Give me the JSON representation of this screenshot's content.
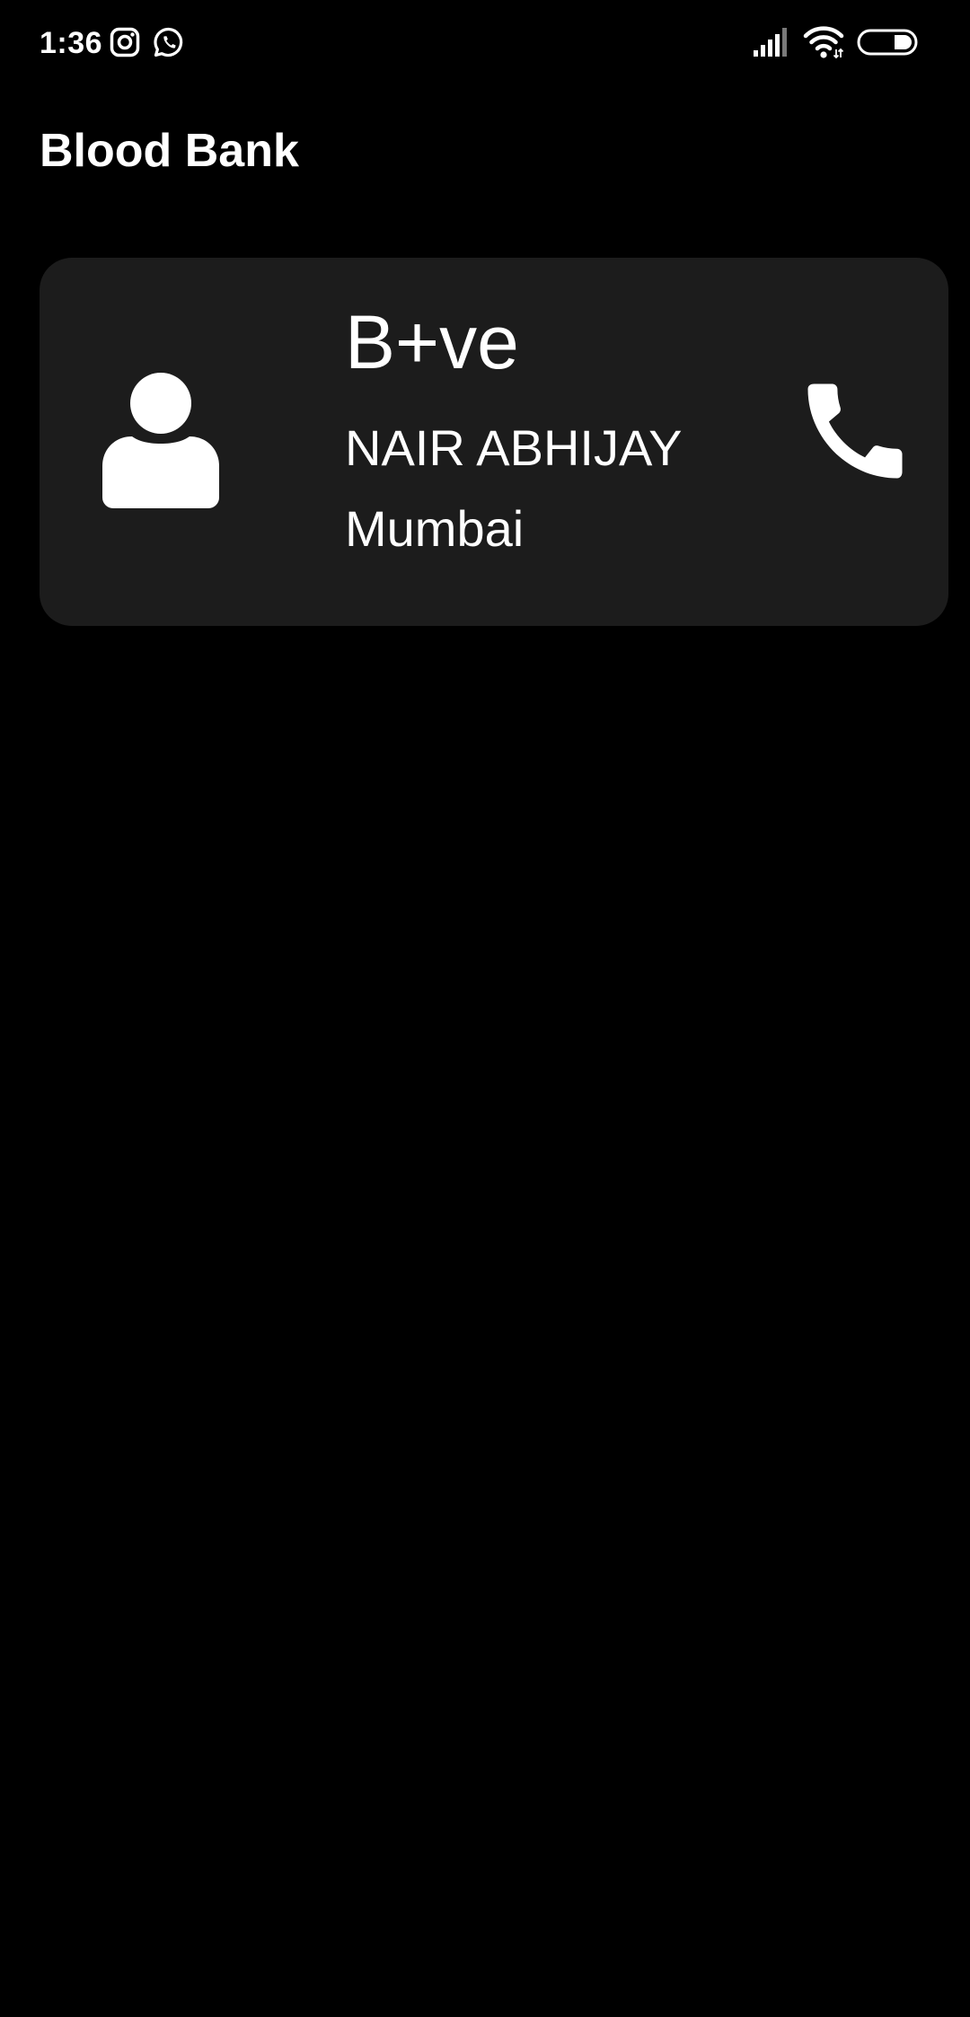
{
  "status_bar": {
    "time": "1:36",
    "left_icons": [
      "instagram-icon",
      "whatsapp-icon"
    ],
    "right_icons": [
      "cellular-signal-icon",
      "wifi-icon",
      "battery-icon"
    ]
  },
  "app": {
    "title": "Blood Bank"
  },
  "donor_card": {
    "avatar_icon": "person-icon",
    "blood_group": "B+ve",
    "name": "NAIR ABHIJAY",
    "city": "Mumbai",
    "call_icon": "phone-icon"
  },
  "colors": {
    "background": "#000000",
    "card": "#1c1c1c",
    "text": "#ffffff"
  }
}
